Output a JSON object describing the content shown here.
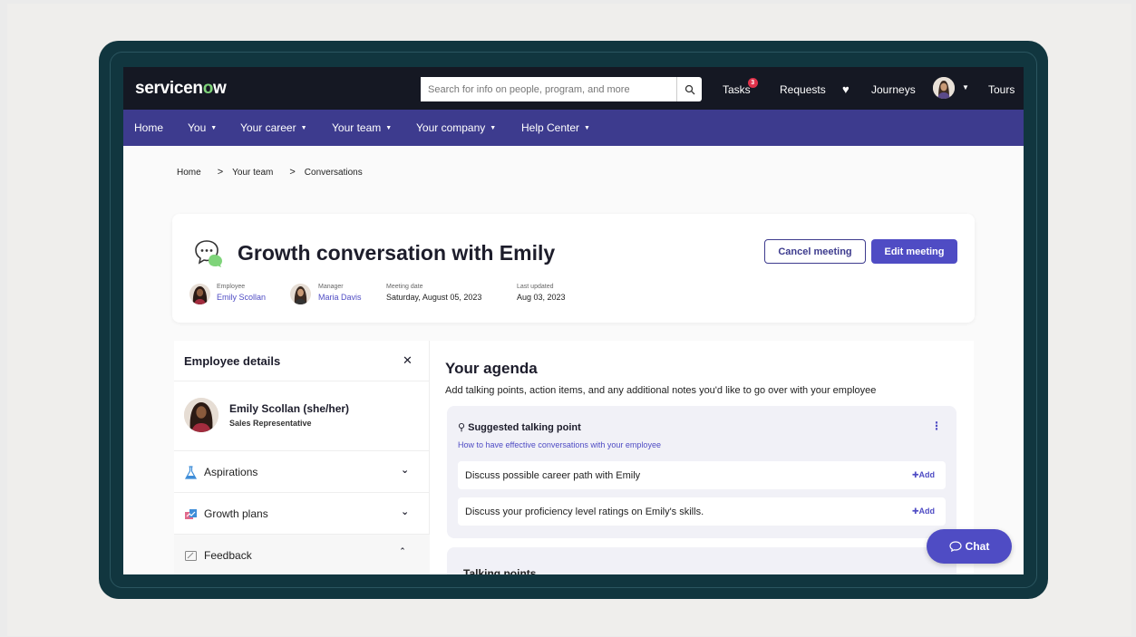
{
  "topbar": {
    "logo_prefix": "servicen",
    "logo_o": "o",
    "logo_suffix": "w",
    "search_placeholder": "Search for info on people, program, and more",
    "tasks_label": "Tasks",
    "tasks_badge": "3",
    "requests_label": "Requests",
    "journeys_label": "Journeys",
    "tours_label": "Tours"
  },
  "nav": {
    "home": "Home",
    "you": "You",
    "your_career": "Your career",
    "your_team": "Your team",
    "your_company": "Your company",
    "help_center": "Help Center"
  },
  "breadcrumb": {
    "home": "Home",
    "your_team": "Your team",
    "current": "Conversations"
  },
  "header": {
    "title": "Growth conversation with Emily",
    "cancel_label": "Cancel meeting",
    "edit_label": "Edit meeting",
    "employee_label": "Employee",
    "employee_name": "Emily Scollan",
    "manager_label": "Manager",
    "manager_name": "Maria Davis",
    "date_label": "Meeting date",
    "date_value": "Saturday, August 05, 2023",
    "updated_label": "Last updated",
    "updated_value": "Aug 03, 2023"
  },
  "details": {
    "title": "Employee details",
    "name": "Emily Scollan (she/her)",
    "role": "Sales Representative",
    "sections": [
      {
        "label": "Aspirations",
        "state": "collapsed"
      },
      {
        "label": "Growth plans",
        "state": "collapsed"
      },
      {
        "label": "Feedback",
        "state": "expanded"
      }
    ]
  },
  "agenda": {
    "title": "Your agenda",
    "subtitle": "Add talking points, action items, and any additional notes you'd like to go over with your employee",
    "suggested_title": "Suggested talking point",
    "suggested_link": "How to have effective conversations with your employee",
    "talking_points": [
      {
        "text": "Discuss possible career path with Emily",
        "action": "Add"
      },
      {
        "text": "Discuss your proficiency level ratings on Emily's skills.",
        "action": "Add"
      }
    ],
    "talking_title": "Talking points"
  },
  "chat": {
    "label": "Chat"
  },
  "colors": {
    "topbar": "#151823",
    "navbar": "#3d3b8e",
    "accent": "#4f4cc4",
    "device_frame": "#11363f"
  }
}
